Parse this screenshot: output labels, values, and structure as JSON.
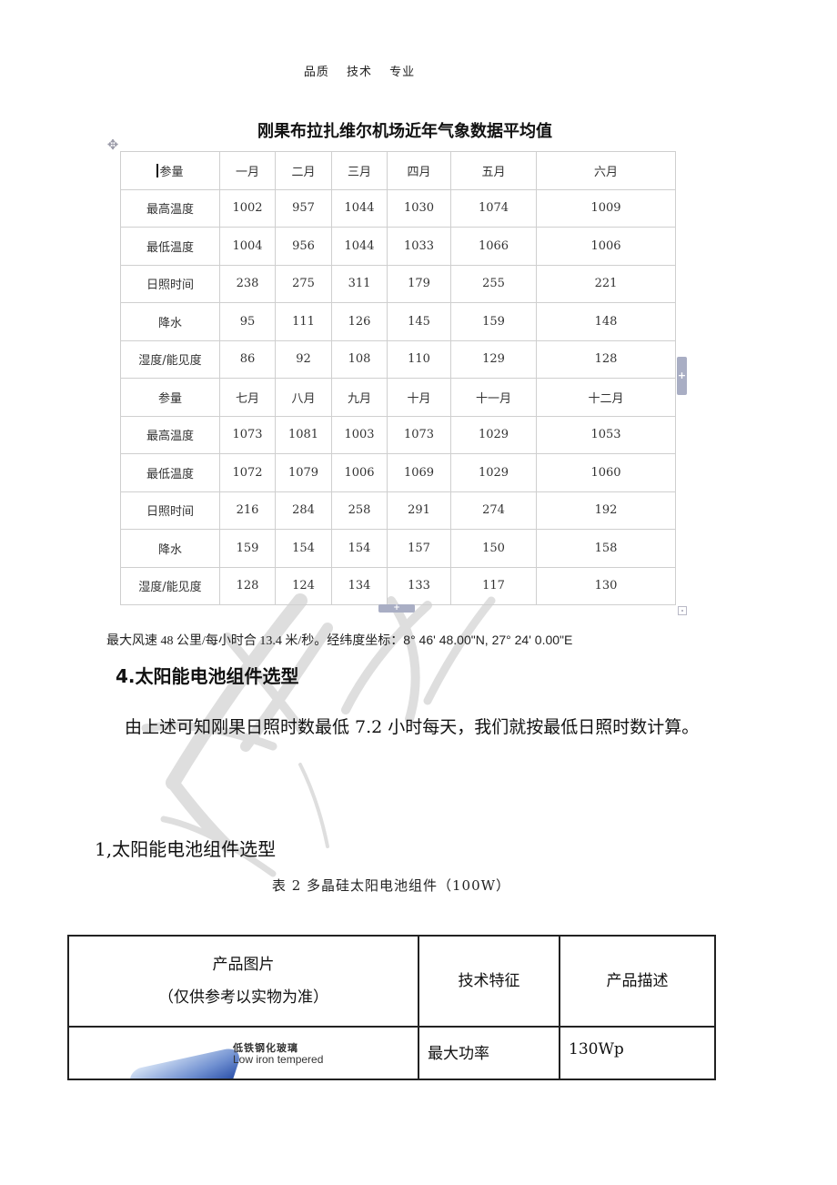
{
  "header": {
    "items": [
      "品质",
      "技术",
      "专业"
    ]
  },
  "weather_table": {
    "title": "刚果布拉扎维尔机场近年气象数据平均值",
    "sections": [
      {
        "header": [
          "参量",
          "一月",
          "二月",
          "三月",
          "四月",
          "五月",
          "六月"
        ],
        "rows": [
          [
            "最高温度",
            "1002",
            "957",
            "1044",
            "1030",
            "1074",
            "1009"
          ],
          [
            "最低温度",
            "1004",
            "956",
            "1044",
            "1033",
            "1066",
            "1006"
          ],
          [
            "日照时间",
            "238",
            "275",
            "311",
            "179",
            "255",
            "221"
          ],
          [
            "降水",
            "95",
            "111",
            "126",
            "145",
            "159",
            "148"
          ],
          [
            "湿度/能见度",
            "86",
            "92",
            "108",
            "110",
            "129",
            "128"
          ]
        ]
      },
      {
        "header": [
          "参量",
          "七月",
          "八月",
          "九月",
          "十月",
          "十一月",
          "十二月"
        ],
        "rows": [
          [
            "最高温度",
            "1073",
            "1081",
            "1003",
            "1073",
            "1029",
            "1053"
          ],
          [
            "最低温度",
            "1072",
            "1079",
            "1006",
            "1069",
            "1029",
            "1060"
          ],
          [
            "日照时间",
            "216",
            "284",
            "258",
            "291",
            "274",
            "192"
          ],
          [
            "降水",
            "159",
            "154",
            "154",
            "157",
            "150",
            "158"
          ],
          [
            "湿度/能见度",
            "128",
            "124",
            "134",
            "133",
            "117",
            "130"
          ]
        ]
      }
    ]
  },
  "note": {
    "text_cn": "最大风速 48 公里/每小时合 13.4 米/秒。经纬度坐标：",
    "coords": "8° 46' 48.00\"N, 27° 24' 0.00\"E"
  },
  "section_heading": "4.太阳能电池组件选型",
  "paragraph": "由上述可知刚果日照时数最低 7.2 小时每天，我们就按最低日照时数计算。",
  "sub_heading": "1,太阳能电池组件选型",
  "caption": "表 2   多晶硅太阳电池组件（100W）",
  "product_table": {
    "headers": {
      "image_line1": "产品图片",
      "image_line2": "（仅供参考以实物为准）",
      "feature": "技术特征",
      "description": "产品描述"
    },
    "rows": [
      {
        "feature": "最大功率",
        "description": "130Wp",
        "image_label_cn": "低铁钢化玻璃",
        "image_label_en": "Low iron tempered"
      }
    ]
  },
  "icons": {
    "move_handle": "four-way-arrow-icon",
    "add_row": "plus-icon",
    "add_column": "plus-icon",
    "resize": "resize-corner-icon"
  }
}
